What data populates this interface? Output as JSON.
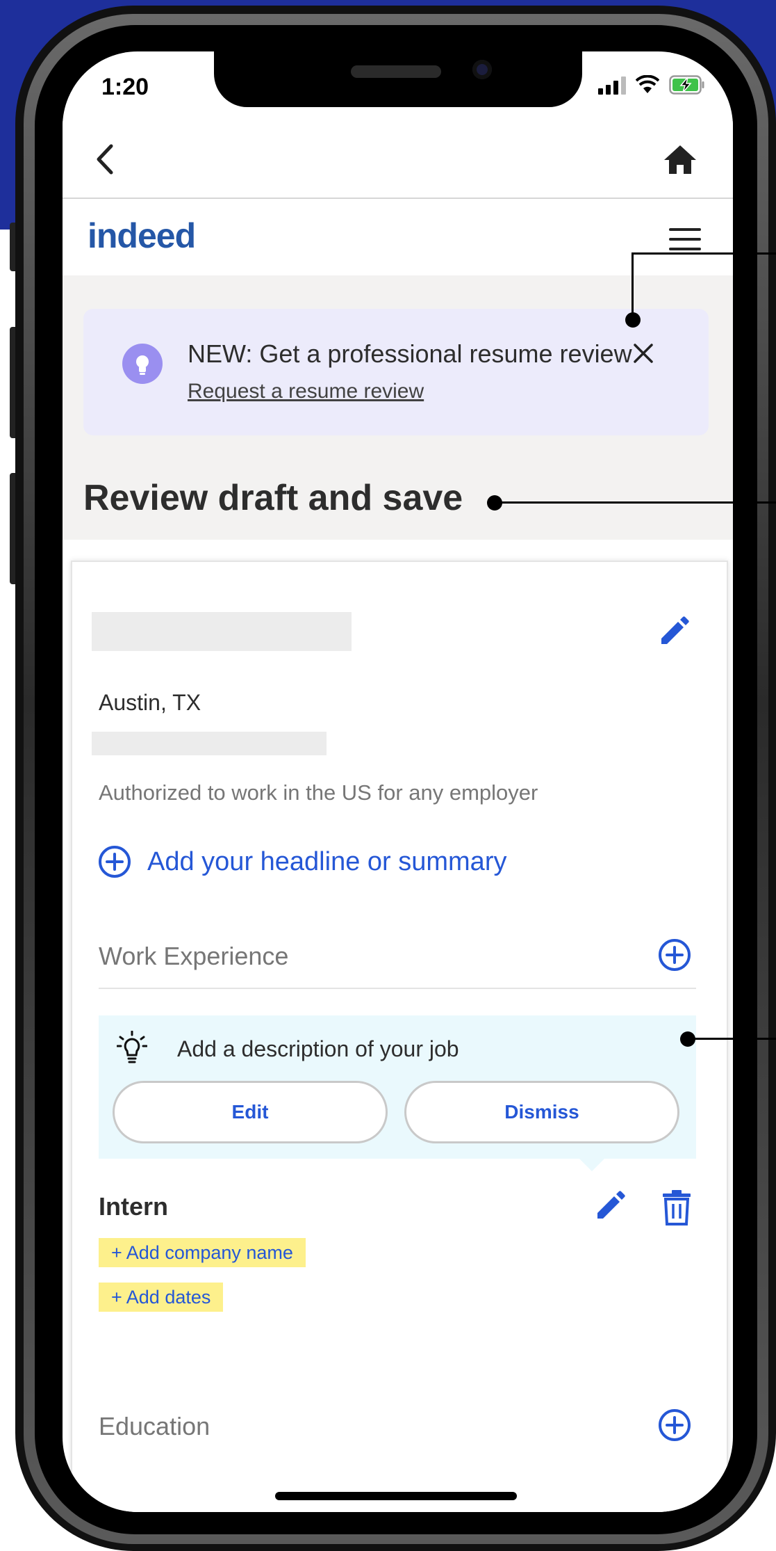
{
  "status_bar": {
    "time": "1:20"
  },
  "brand": {
    "logo": "indeed"
  },
  "banner": {
    "title": "NEW: Get a professional resume review",
    "link": "Request a resume review"
  },
  "page": {
    "title": "Review draft and save"
  },
  "profile": {
    "location": "Austin, TX",
    "authorization": "Authorized to work in the US for any employer",
    "add_headline": "Add your headline or summary"
  },
  "work_experience": {
    "label": "Work Experience",
    "tip": {
      "text": "Add a description of your job",
      "edit_label": "Edit",
      "dismiss_label": "Dismiss"
    },
    "job": {
      "title": "Intern",
      "add_company": "+ Add company name",
      "add_dates": "+ Add dates"
    }
  },
  "education": {
    "label": "Education"
  },
  "colors": {
    "brand_blue": "#2557a7",
    "action_blue": "#2557d6",
    "banner_bg": "#ecebfb",
    "tip_bg": "#eaf9fd",
    "chip_bg": "#fdf08c",
    "background_blue": "#1e2f9b"
  },
  "icons": {
    "back": "chevron-left-icon",
    "home": "home-icon",
    "menu": "hamburger-icon",
    "banner_bulb": "lightbulb-icon",
    "close": "close-icon",
    "edit": "pencil-icon",
    "add": "plus-circle-icon",
    "tip": "lightbulb-outline-icon",
    "delete": "trash-icon"
  }
}
